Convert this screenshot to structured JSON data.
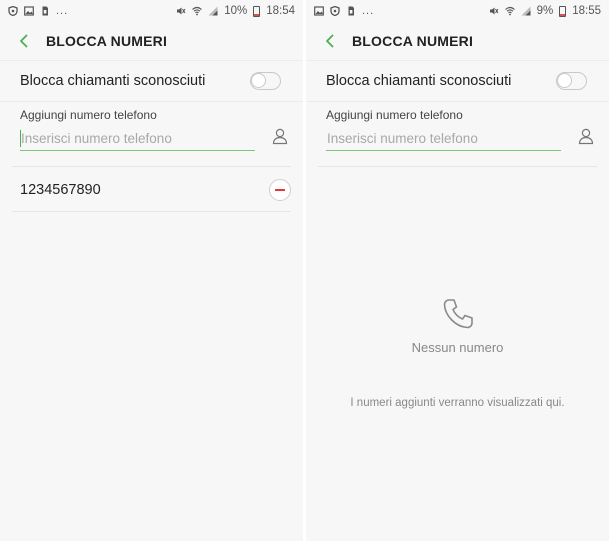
{
  "left": {
    "status": {
      "battery": "10%",
      "time": "18:54",
      "dots": "..."
    },
    "header": {
      "title": "BLOCCA NUMERI"
    },
    "toggle": {
      "label": "Blocca chiamanti sconosciuti",
      "enabled": false
    },
    "add": {
      "label": "Aggiungi numero telefono",
      "placeholder": "Inserisci numero telefono",
      "value": ""
    },
    "numbers": [
      "1234567890"
    ]
  },
  "right": {
    "status": {
      "battery": "9%",
      "time": "18:55",
      "dots": "..."
    },
    "header": {
      "title": "BLOCCA NUMERI"
    },
    "toggle": {
      "label": "Blocca chiamanti sconosciuti",
      "enabled": false
    },
    "add": {
      "label": "Aggiungi numero telefono",
      "placeholder": "Inserisci numero telefono",
      "value": ""
    },
    "empty": {
      "title": "Nessun numero",
      "subtitle": "I numeri aggiunti verranno visualizzati qui."
    }
  },
  "colors": {
    "accent": "#4caf50",
    "remove": "#e53935",
    "background": "#f7f7f7"
  },
  "icons": [
    "shield-icon",
    "image-icon",
    "sim-icon",
    "mute-icon",
    "wifi-icon",
    "signal-icon",
    "battery-icon",
    "back-icon",
    "contact-icon",
    "remove-icon",
    "phone-icon"
  ]
}
